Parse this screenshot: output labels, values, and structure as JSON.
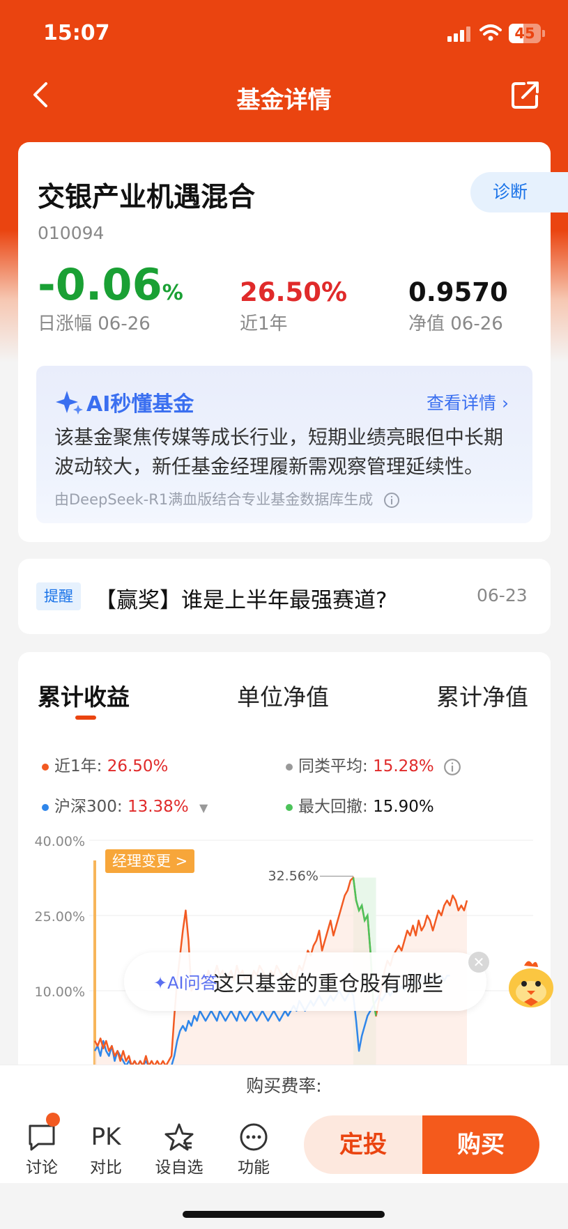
{
  "status": {
    "time": "15:07",
    "battery": "45"
  },
  "nav": {
    "title": "基金详情"
  },
  "fund": {
    "name": "交银产业机遇混合",
    "code": "010094",
    "diagnose_label": "诊断",
    "day_change_value": "-0.06",
    "day_change_unit": "%",
    "day_change_label": "日涨幅 06-26",
    "year_return": "26.50%",
    "year_label": "近1年",
    "nav_value": "0.9570",
    "nav_label": "净值 06-26"
  },
  "ai_card": {
    "title": "AI秒懂基金",
    "more": "查看详情",
    "text": "该基金聚焦传媒等成长行业，短期业绩亮眼但中长期波动较大，新任基金经理履新需观察管理延续性。",
    "source": "由DeepSeek-R1满血版结合专业基金数据库生成"
  },
  "reminder": {
    "tag": "提醒",
    "text": "【赢奖】谁是上半年最强赛道?",
    "date": "06-23"
  },
  "tabs": [
    "累计收益",
    "单位净值",
    "累计净值"
  ],
  "legend": {
    "fund_label": "近1年:",
    "fund_value": "26.50%",
    "peer_label": "同类平均:",
    "peer_value": "15.28%",
    "index_label": "沪深300:",
    "index_value": "13.38%",
    "drawdown_label": "最大回撤:",
    "drawdown_value": "15.90%"
  },
  "chart_data": {
    "type": "line",
    "y_ticks": [
      "40.00%",
      "25.00%",
      "10.00%"
    ],
    "ylim": [
      -5,
      40
    ],
    "peak_label": "32.56%",
    "manager_change_label": "经理变更 >",
    "series": [
      {
        "name": "近1年",
        "color": "#f25a22",
        "values": [
          0,
          -1,
          0.5,
          -1.5,
          0,
          -2,
          -1,
          -3,
          -2,
          -4,
          -2,
          -4,
          -3,
          -5,
          -4,
          -5,
          -4,
          -5,
          -3,
          -5,
          -4,
          -5,
          -4,
          -5,
          -4,
          -5,
          -4,
          -3,
          5,
          12,
          17,
          22,
          26,
          20,
          10,
          11,
          12,
          11,
          13,
          12,
          14,
          12,
          13,
          15,
          13,
          14,
          12,
          13,
          14,
          12,
          15,
          13,
          14,
          12,
          13,
          12,
          14,
          13,
          15,
          14,
          13,
          12,
          14,
          13,
          15,
          14,
          13,
          12,
          13,
          14,
          12,
          13,
          15,
          14,
          16,
          18,
          17,
          19,
          20,
          22,
          18,
          20,
          22,
          24,
          21,
          23,
          25,
          27,
          29,
          30,
          32,
          32.56,
          28,
          26,
          27,
          24,
          25,
          18,
          8,
          5,
          8,
          11,
          14,
          16,
          15,
          17,
          18,
          19,
          18,
          20,
          22,
          21,
          23,
          21,
          24,
          22,
          23,
          25,
          24,
          22,
          24,
          26,
          25,
          27,
          28,
          27,
          29,
          28,
          26,
          27,
          26,
          28
        ]
      },
      {
        "name": "沪深300",
        "color": "#2f86ea",
        "values": [
          -2,
          -1,
          -3,
          0,
          -2,
          -3,
          -1,
          -4,
          -2,
          -3,
          -4,
          -5,
          -4,
          -5,
          -4,
          -5,
          -4,
          -5,
          -4,
          -5,
          -5,
          -5,
          -5,
          -5,
          -5,
          -5,
          -5,
          -5,
          -3,
          0,
          2,
          3,
          2,
          4,
          3,
          5,
          4,
          6,
          5,
          4,
          5,
          6,
          5,
          4,
          6,
          5,
          4,
          5,
          6,
          5,
          4,
          6,
          5,
          4,
          5,
          6,
          5,
          4,
          5,
          6,
          5,
          4,
          5,
          6,
          5,
          4,
          5,
          6,
          5,
          6,
          7,
          6,
          8,
          7,
          6,
          7,
          8,
          7,
          8,
          9,
          8,
          7,
          8,
          9,
          8,
          9,
          10,
          9,
          8,
          9,
          10,
          9,
          4,
          -2,
          1,
          3,
          5,
          6,
          7,
          8,
          9,
          8,
          9,
          10,
          9,
          10,
          11,
          10,
          11,
          10,
          11,
          12,
          11,
          12,
          11,
          12,
          13,
          12,
          13,
          12,
          13,
          12,
          13,
          12,
          13,
          13
        ]
      }
    ]
  },
  "ai_qa": {
    "tag": "AI问答",
    "question": "这只基金的重仓股有哪些"
  },
  "fee_label": "购买费率:",
  "bottom_bar": {
    "discuss": "讨论",
    "pk_icon_text": "PK",
    "compare": "对比",
    "watchlist": "设自选",
    "functions": "功能",
    "sip": "定投",
    "buy": "购买"
  }
}
